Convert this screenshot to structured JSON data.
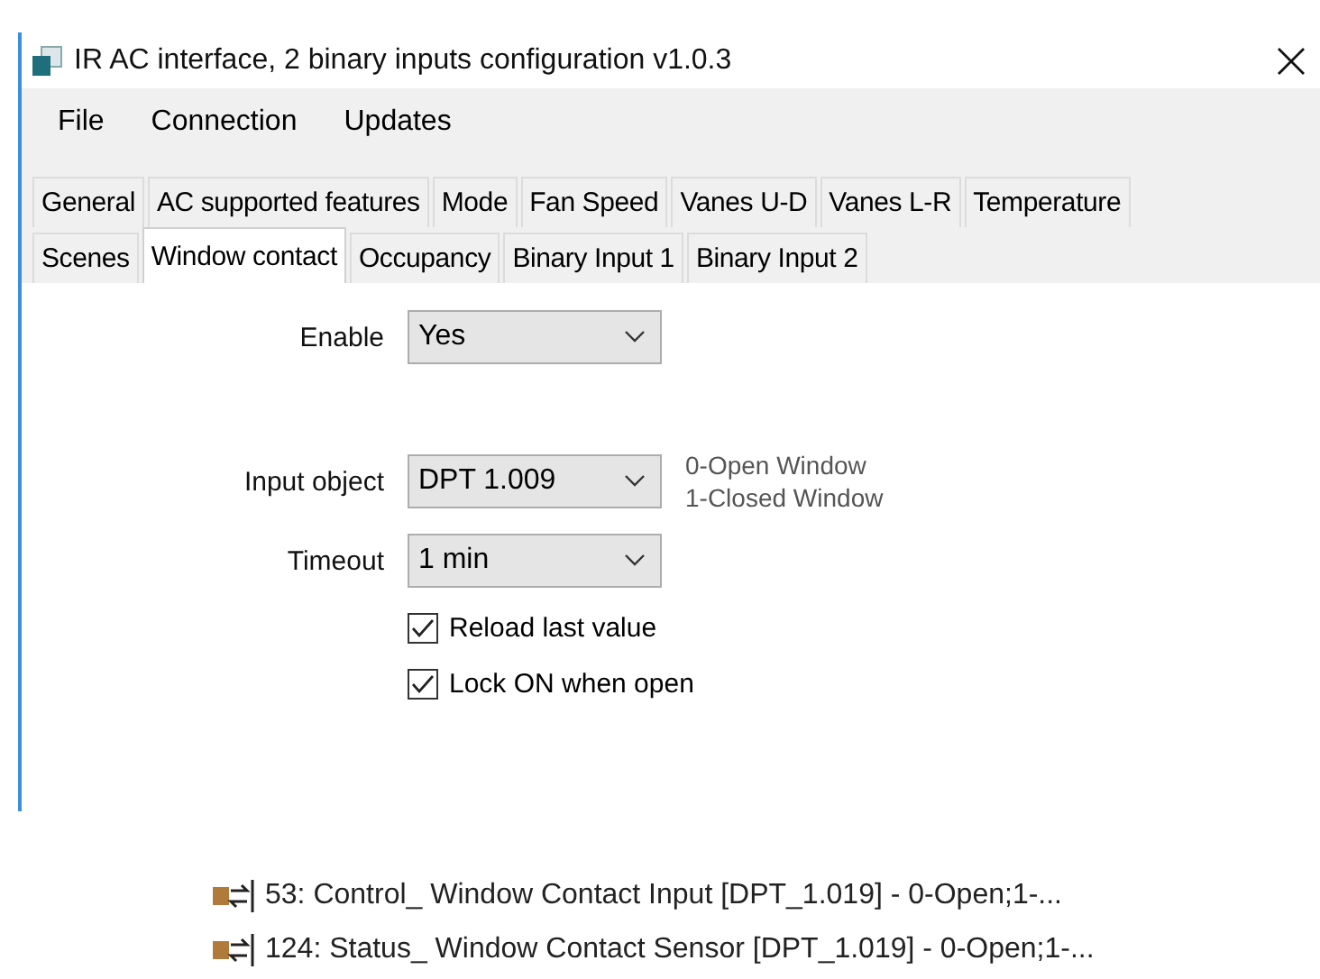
{
  "window": {
    "title": "IR AC interface, 2 binary inputs configuration v1.0.3"
  },
  "menu": [
    "File",
    "Connection",
    "Updates"
  ],
  "tab_rows": [
    [
      {
        "label": "General",
        "selected": false
      },
      {
        "label": "AC supported features",
        "selected": false
      },
      {
        "label": "Mode",
        "selected": false
      },
      {
        "label": "Fan Speed",
        "selected": false
      },
      {
        "label": "Vanes U-D",
        "selected": false
      },
      {
        "label": "Vanes L-R",
        "selected": false
      },
      {
        "label": "Temperature",
        "selected": false
      }
    ],
    [
      {
        "label": "Scenes",
        "selected": false
      },
      {
        "label": "Window contact",
        "selected": true
      },
      {
        "label": "Occupancy",
        "selected": false
      },
      {
        "label": "Binary Input 1",
        "selected": false
      },
      {
        "label": "Binary Input 2",
        "selected": false
      }
    ]
  ],
  "fields": [
    {
      "kind": "dropdown",
      "label": "Enable",
      "value": "Yes"
    },
    {
      "kind": "dropdown",
      "label": "Input object",
      "value": "DPT 1.009",
      "hint": [
        "0-Open Window",
        "1-Closed Window"
      ]
    },
    {
      "kind": "dropdown",
      "label": "Timeout",
      "value": "1 min"
    },
    {
      "kind": "checkbox",
      "label": "Reload last value",
      "checked": true
    },
    {
      "kind": "checkbox",
      "label": "Lock ON when open",
      "checked": true
    }
  ],
  "objects": [
    "53: Control_ Window Contact Input [DPT_1.019] - 0-Open;1-...",
    "124: Status_ Window Contact Sensor [DPT_1.019] - 0-Open;1-..."
  ]
}
